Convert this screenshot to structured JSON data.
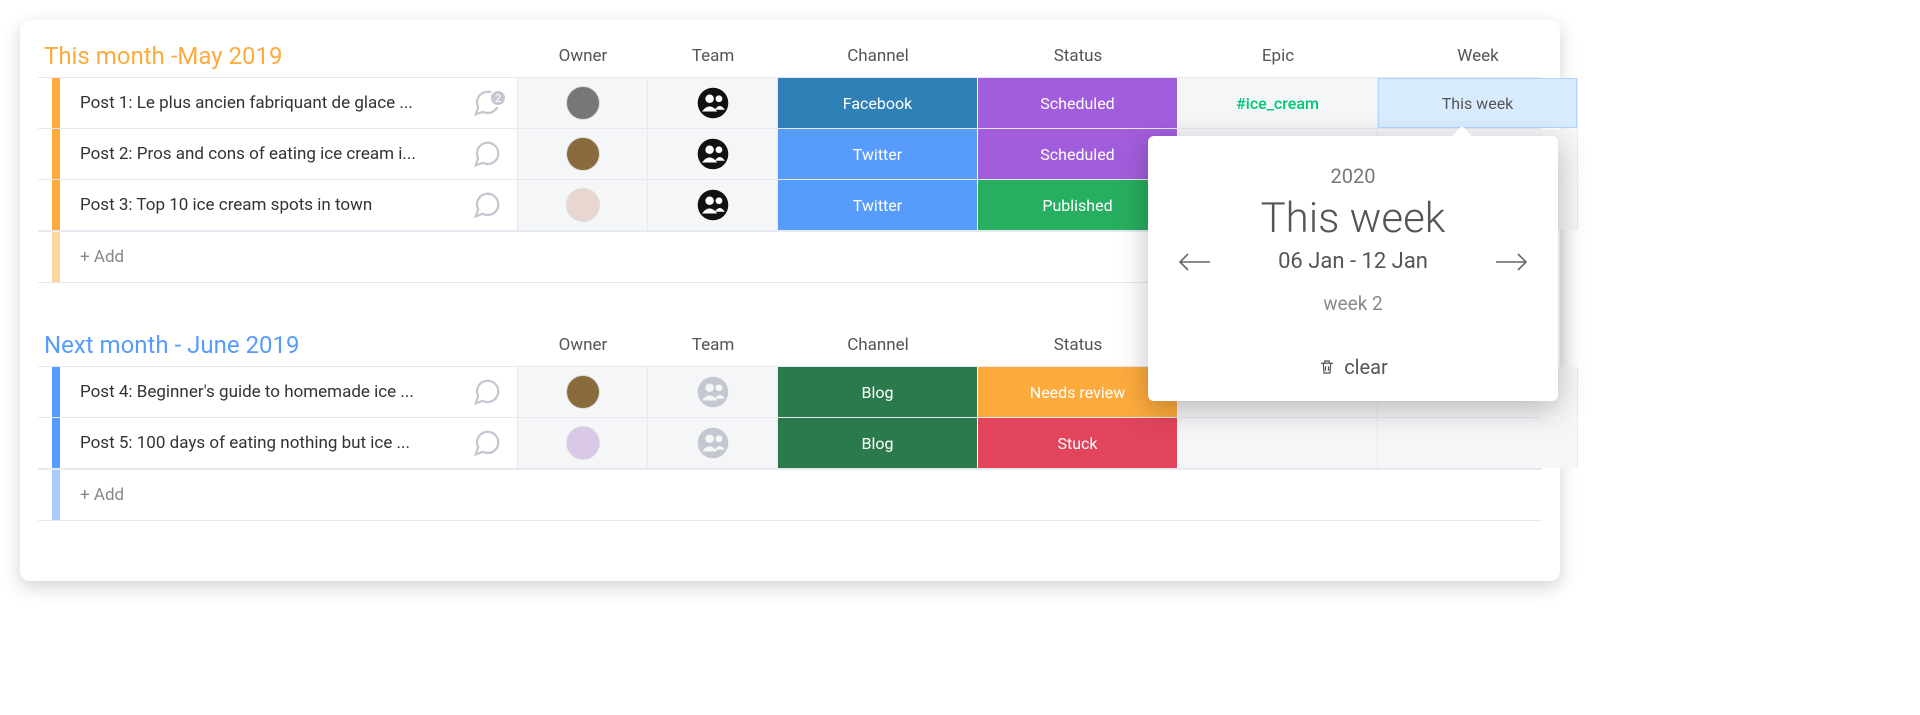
{
  "columns": {
    "owner": "Owner",
    "team": "Team",
    "channel": "Channel",
    "status": "Status",
    "epic": "Epic",
    "week": "Week"
  },
  "groups": [
    {
      "id": "g1",
      "title": "This month -May 2019",
      "rows": [
        {
          "name": "Post 1: Le plus ancien fabriquant de glace ...",
          "chat_count": "2",
          "owner_color": "#6b3b3b",
          "team_filled": true,
          "channel": "Facebook",
          "channel_class": "c-facebook",
          "status": "Scheduled",
          "status_class": "c-scheduled",
          "epic": "#ice_cream",
          "week": "This week",
          "week_selected": true
        },
        {
          "name": "Post 2: Pros and cons of eating ice cream i...",
          "chat_count": "",
          "owner_color": "#8a6b3b",
          "team_filled": true,
          "channel": "Twitter",
          "channel_class": "c-twitter",
          "status": "Scheduled",
          "status_class": "c-scheduled",
          "epic": "",
          "week": ""
        },
        {
          "name": "Post 3: Top 10 ice cream spots in town",
          "chat_count": "",
          "owner_color": "#e8d7cf",
          "team_filled": true,
          "channel": "Twitter",
          "channel_class": "c-twitter",
          "status": "Published",
          "status_class": "c-published",
          "epic": "",
          "week": ""
        }
      ],
      "add_label": "+ Add"
    },
    {
      "id": "g2",
      "title": "Next month - June 2019",
      "rows": [
        {
          "name": "Post 4: Beginner's guide to homemade ice ...",
          "chat_count": "",
          "owner_color": "#8a6b3b",
          "team_filled": false,
          "channel": "Blog",
          "channel_class": "c-blog",
          "status": "Needs review",
          "status_class": "c-needs",
          "epic": "",
          "week": ""
        },
        {
          "name": "Post 5: 100 days of eating nothing but ice ...",
          "chat_count": "",
          "owner_color": "#d9c7e8",
          "team_filled": false,
          "channel": "Blog",
          "channel_class": "c-blog",
          "status": "Stuck",
          "status_class": "c-stuck",
          "epic": "",
          "week": ""
        }
      ],
      "add_label": "+ Add"
    }
  ],
  "week_popover": {
    "year": "2020",
    "title": "This week",
    "range": "06 Jan  -  12 Jan",
    "week_number": "week 2",
    "clear_label": "clear"
  }
}
